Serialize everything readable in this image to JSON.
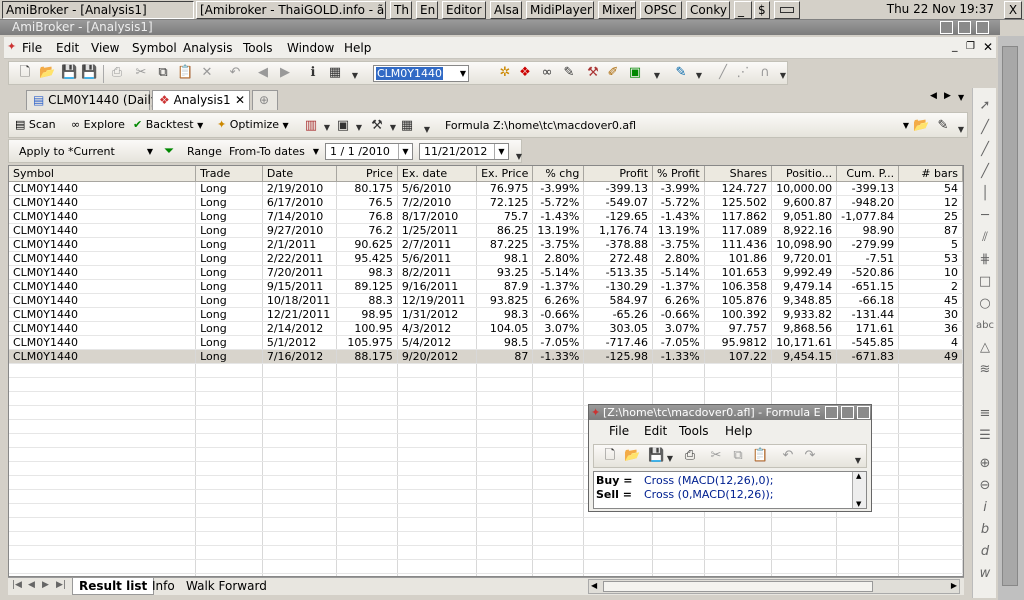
{
  "taskbar": {
    "buttons": [
      "AmiBroker - [Analysis1]",
      "[Amibroker - ThaiGOLD.info - ã",
      "Th",
      "En",
      "Editor",
      "Alsa",
      "MidiPlayer",
      "Mixer",
      "OPSC",
      "Conky",
      "_",
      "$"
    ],
    "clock": "Thu 22 Nov 19:37",
    "close": "X"
  },
  "window": {
    "title": "AmiBroker - [Analysis1]"
  },
  "menu": [
    "File",
    "Edit",
    "View",
    "Symbol",
    "Analysis",
    "Tools",
    "Window",
    "Help"
  ],
  "toolbar": {
    "symbol": "CLM0Y1440"
  },
  "tabs": [
    {
      "label": "CLM0Y1440 (Daily"
    },
    {
      "label": "Analysis1"
    }
  ],
  "analysis_toolbar": {
    "scan": "Scan",
    "explore": "Explore",
    "backtest": "Backtest",
    "optimize": "Optimize",
    "formula_label": "Formula",
    "formula_path": "Z:\\home\\tc\\macdover0.afl"
  },
  "range_bar": {
    "apply_to_label": "Apply to",
    "apply_to_value": "*Current",
    "range_label": "Range",
    "range_value": "From-To dates",
    "from_date": "1 / 1 /2010",
    "to_date": "11/21/2012"
  },
  "columns": [
    "Symbol",
    "Trade",
    "Date",
    "Price",
    "Ex. date",
    "Ex. Price",
    "% chg",
    "Profit",
    "% Profit",
    "Shares",
    "Positio...",
    "Cum. P...",
    "# bars"
  ],
  "rows": [
    [
      "CLM0Y1440",
      "Long",
      "2/19/2010",
      "80.175",
      "5/6/2010",
      "76.975",
      "-3.99%",
      "-399.13",
      "-3.99%",
      "124.727",
      "10,000.00",
      "-399.13",
      "54"
    ],
    [
      "CLM0Y1440",
      "Long",
      "6/17/2010",
      "76.5",
      "7/2/2010",
      "72.125",
      "-5.72%",
      "-549.07",
      "-5.72%",
      "125.502",
      "9,600.87",
      "-948.20",
      "12"
    ],
    [
      "CLM0Y1440",
      "Long",
      "7/14/2010",
      "76.8",
      "8/17/2010",
      "75.7",
      "-1.43%",
      "-129.65",
      "-1.43%",
      "117.862",
      "9,051.80",
      "-1,077.84",
      "25"
    ],
    [
      "CLM0Y1440",
      "Long",
      "9/27/2010",
      "76.2",
      "1/25/2011",
      "86.25",
      "13.19%",
      "1,176.74",
      "13.19%",
      "117.089",
      "8,922.16",
      "98.90",
      "87"
    ],
    [
      "CLM0Y1440",
      "Long",
      "2/1/2011",
      "90.625",
      "2/7/2011",
      "87.225",
      "-3.75%",
      "-378.88",
      "-3.75%",
      "111.436",
      "10,098.90",
      "-279.99",
      "5"
    ],
    [
      "CLM0Y1440",
      "Long",
      "2/22/2011",
      "95.425",
      "5/6/2011",
      "98.1",
      "2.80%",
      "272.48",
      "2.80%",
      "101.86",
      "9,720.01",
      "-7.51",
      "53"
    ],
    [
      "CLM0Y1440",
      "Long",
      "7/20/2011",
      "98.3",
      "8/2/2011",
      "93.25",
      "-5.14%",
      "-513.35",
      "-5.14%",
      "101.653",
      "9,992.49",
      "-520.86",
      "10"
    ],
    [
      "CLM0Y1440",
      "Long",
      "9/15/2011",
      "89.125",
      "9/16/2011",
      "87.9",
      "-1.37%",
      "-130.29",
      "-1.37%",
      "106.358",
      "9,479.14",
      "-651.15",
      "2"
    ],
    [
      "CLM0Y1440",
      "Long",
      "10/18/2011",
      "88.3",
      "12/19/2011",
      "93.825",
      "6.26%",
      "584.97",
      "6.26%",
      "105.876",
      "9,348.85",
      "-66.18",
      "45"
    ],
    [
      "CLM0Y1440",
      "Long",
      "12/21/2011",
      "98.95",
      "1/31/2012",
      "98.3",
      "-0.66%",
      "-65.26",
      "-0.66%",
      "100.392",
      "9,933.82",
      "-131.44",
      "30"
    ],
    [
      "CLM0Y1440",
      "Long",
      "2/14/2012",
      "100.95",
      "4/3/2012",
      "104.05",
      "3.07%",
      "303.05",
      "3.07%",
      "97.757",
      "9,868.56",
      "171.61",
      "36"
    ],
    [
      "CLM0Y1440",
      "Long",
      "5/1/2012",
      "105.975",
      "5/4/2012",
      "98.5",
      "-7.05%",
      "-717.46",
      "-7.05%",
      "95.9812",
      "10,171.61",
      "-545.85",
      "4"
    ],
    [
      "CLM0Y1440",
      "Long",
      "7/16/2012",
      "88.175",
      "9/20/2012",
      "87",
      "-1.33%",
      "-125.98",
      "-1.33%",
      "107.22",
      "9,454.15",
      "-671.83",
      "49"
    ]
  ],
  "bottom_tabs": [
    "Result list",
    "Info",
    "Walk Forward"
  ],
  "formula_editor": {
    "title": "[Z:\\home\\tc\\macdover0.afl] - Formula E",
    "menu": [
      "File",
      "Edit",
      "Tools",
      "Help"
    ],
    "line1_keyword": "Buy =",
    "line1_code": "Cross (MACD(12,26),0);",
    "line2_keyword": "Sell =",
    "line2_code": "Cross (0,MACD(12,26));"
  },
  "right_panel": {
    "text_tool": "abc"
  }
}
